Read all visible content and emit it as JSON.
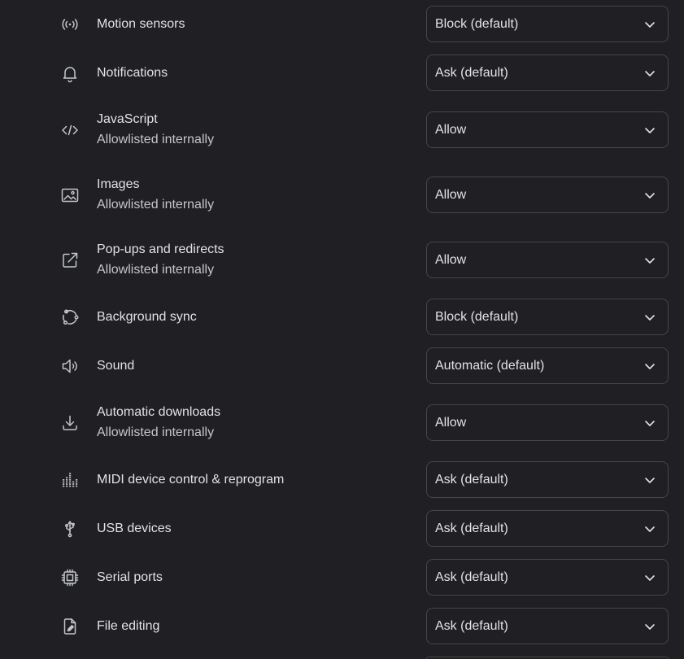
{
  "permissions": [
    {
      "label": "Motion sensors",
      "sublabel": "",
      "value": "Block (default)",
      "icon": "motion-sensor-icon"
    },
    {
      "label": "Notifications",
      "sublabel": "",
      "value": "Ask (default)",
      "icon": "bell-icon"
    },
    {
      "label": "JavaScript",
      "sublabel": "Allowlisted internally",
      "value": "Allow",
      "icon": "code-icon"
    },
    {
      "label": "Images",
      "sublabel": "Allowlisted internally",
      "value": "Allow",
      "icon": "image-icon"
    },
    {
      "label": "Pop-ups and redirects",
      "sublabel": "Allowlisted internally",
      "value": "Allow",
      "icon": "external-link-icon"
    },
    {
      "label": "Background sync",
      "sublabel": "",
      "value": "Block (default)",
      "icon": "sync-icon"
    },
    {
      "label": "Sound",
      "sublabel": "",
      "value": "Automatic (default)",
      "icon": "speaker-icon"
    },
    {
      "label": "Automatic downloads",
      "sublabel": "Allowlisted internally",
      "value": "Allow",
      "icon": "download-icon"
    },
    {
      "label": "MIDI device control & reprogram",
      "sublabel": "",
      "value": "Ask (default)",
      "icon": "midi-icon"
    },
    {
      "label": "USB devices",
      "sublabel": "",
      "value": "Ask (default)",
      "icon": "usb-icon"
    },
    {
      "label": "Serial ports",
      "sublabel": "",
      "value": "Ask (default)",
      "icon": "chip-icon"
    },
    {
      "label": "File editing",
      "sublabel": "",
      "value": "Ask (default)",
      "icon": "file-edit-icon"
    }
  ],
  "theme": {
    "background": "#1f1f24",
    "text": "#e3e3e3",
    "secondary_text": "#c4c7c5",
    "border": "#474747"
  }
}
